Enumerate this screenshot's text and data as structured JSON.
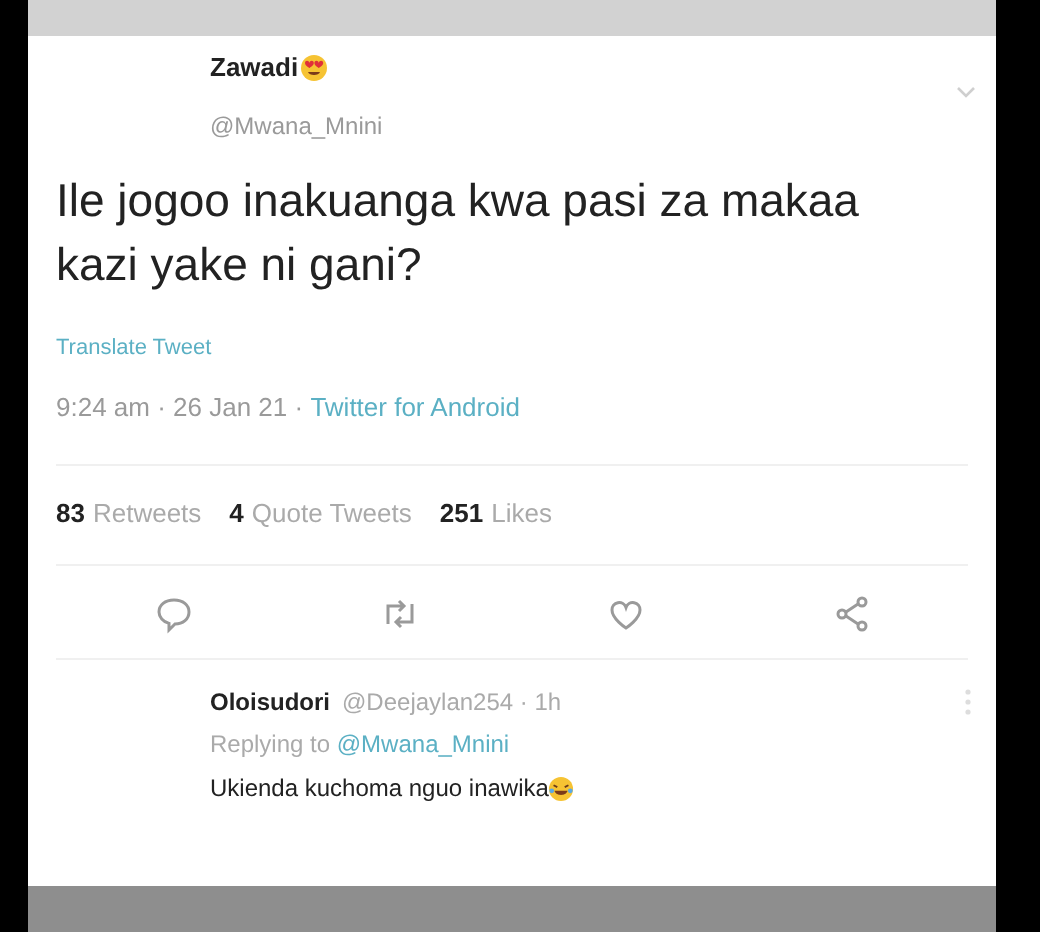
{
  "tweet": {
    "name": "Zawadi",
    "handle": "@Mwana_Mnini",
    "text": "Ile jogoo inakuanga kwa pasi za makaa kazi yake ni gani?",
    "translate": "Translate Tweet",
    "time": "9:24 am · 26 Jan 21 · ",
    "source": "Twitter for Android",
    "stats": [
      {
        "count": "83",
        "label": "Retweets"
      },
      {
        "count": "4",
        "label": "Quote Tweets"
      },
      {
        "count": "251",
        "label": "Likes"
      }
    ],
    "actions": [
      {
        "kind": "reply"
      },
      {
        "kind": "retweet"
      },
      {
        "kind": "like"
      },
      {
        "kind": "share"
      }
    ]
  },
  "reply": {
    "name": "Oloisudori",
    "meta": "@Deejaylan254 · 1h",
    "replying_prefix": "Replying to ",
    "replying_to": "@Mwana_Mnini",
    "text": "Ukienda kuchoma nguo inawika"
  }
}
